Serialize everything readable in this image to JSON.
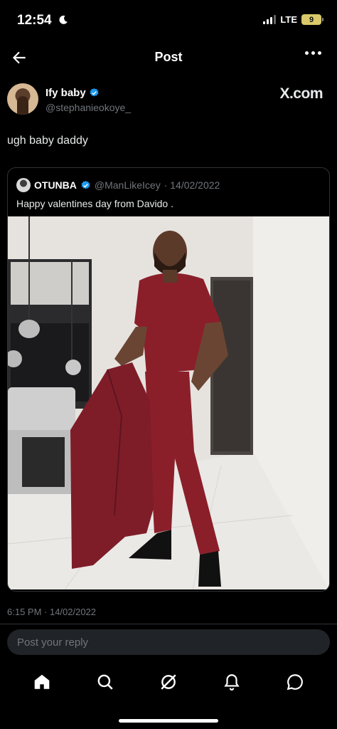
{
  "status_bar": {
    "time": "12:54",
    "network": "LTE",
    "battery": "9"
  },
  "header": {
    "title": "Post"
  },
  "author": {
    "name": "Ify baby",
    "handle": "@stephanieokoye_",
    "watermark": "X.com"
  },
  "tweet": {
    "text": "ugh baby daddy",
    "timestamp": "6:15 PM · 14/02/2022"
  },
  "quoted": {
    "name": "OTUNBA",
    "handle": "@ManLikeIcey",
    "date": "· 14/02/2022",
    "text": "Happy valentines day from Davido ."
  },
  "reply": {
    "placeholder": "Post your reply"
  },
  "tabs": [
    {
      "icon": "home-icon"
    },
    {
      "icon": "search-icon"
    },
    {
      "icon": "grok-icon"
    },
    {
      "icon": "bell-icon"
    },
    {
      "icon": "messages-icon"
    }
  ],
  "colors": {
    "background": "#000000",
    "text": "#e7e9ea",
    "muted": "#71767b",
    "verified": "#1d9bf0",
    "border": "#2f3336",
    "outfit": "#8a1f2a"
  }
}
